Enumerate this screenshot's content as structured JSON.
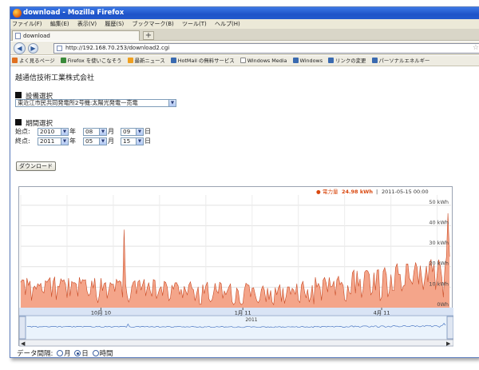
{
  "window": {
    "title": "download - Mozilla Firefox"
  },
  "menu": [
    "ファイル(F)",
    "編集(E)",
    "表示(V)",
    "履歴(S)",
    "ブックマーク(B)",
    "ツール(T)",
    "ヘルプ(H)"
  ],
  "tab": {
    "label": "download",
    "new_tab": "+"
  },
  "nav": {
    "back": "◀",
    "forward": "▶",
    "url": "http://192.168.70.253/download2.cgi",
    "star": "☆"
  },
  "bookmarks": [
    {
      "label": "よく見るページ",
      "color": "#e07020"
    },
    {
      "label": "Firefox を使いこなそう",
      "color": "#3a8a3a"
    },
    {
      "label": "最新ニュース",
      "color": "#f0a020"
    },
    {
      "label": "HotMail の無料サービス",
      "color": "#3a6ab0"
    },
    {
      "label": "Windows Media",
      "color": "#ffffff"
    },
    {
      "label": "Windows",
      "color": "#3a6ab0"
    },
    {
      "label": "リンクの変更",
      "color": "#3a6ab0"
    },
    {
      "label": "パーソナルエネルギー",
      "color": "#3a6ab0"
    }
  ],
  "page": {
    "company": "越通信技術工業株式会社",
    "equipment_heading": "設備選択",
    "equipment_value": "東近江市民共同発電所2号機:太陽光発電一売電",
    "period_heading": "期間選択",
    "start_label": "始点:",
    "end_label": "終点:",
    "start": {
      "year": "2010",
      "month": "08",
      "day": "09"
    },
    "end": {
      "year": "2011",
      "month": "05",
      "day": "15"
    },
    "unit_year": "年",
    "unit_month": "月",
    "unit_day": "日",
    "download_button": "ダウンロード",
    "interval_label": "データ間隔:",
    "interval_options": [
      {
        "label": "月",
        "selected": false
      },
      {
        "label": "日",
        "selected": true
      },
      {
        "label": "時間",
        "selected": false
      }
    ]
  },
  "chart_data": {
    "type": "area",
    "legend_marker": "●",
    "legend_series": "電力量",
    "legend_value": "24.98 kWh",
    "legend_datetime": "2011-05-15 00:00",
    "series_color": "#f4a58a",
    "line_color": "#c94a24",
    "ylim": [
      0,
      55
    ],
    "y_ticks": [
      "0Wh",
      "10 kWh",
      "20 kWh",
      "30 kWh",
      "40 kWh",
      "50 kWh"
    ],
    "y_tick_values": [
      0,
      10,
      20,
      30,
      40,
      50
    ],
    "x_tick_labels": [
      "10月 10",
      "1月 11",
      "4月 11"
    ],
    "x_tick_days": [
      52,
      144,
      234
    ],
    "navigator_label": "2011",
    "grid": true,
    "days": 280,
    "values": [
      12.5,
      13.6,
      13.4,
      6.3,
      14.4,
      11,
      12.9,
      3.5,
      9.6,
      10.5,
      9.1,
      11.7,
      10.7,
      11.8,
      8,
      7.2,
      13.1,
      12.4,
      13.6,
      14.6,
      5.4,
      12.9,
      15,
      3.9,
      10.5,
      10.1,
      14.1,
      12.9,
      13.6,
      11.5,
      4.9,
      14.3,
      5.7,
      12.8,
      12.1,
      12.2,
      11.5,
      5.6,
      14.8,
      11.8,
      13.7,
      13.3,
      13.6,
      7.9,
      5.9,
      6.8,
      13.1,
      9.6,
      14.4,
      5.6,
      2.4,
      6.3,
      14.3,
      8.3,
      11.7,
      12.2,
      4.6,
      8.2,
      12.2,
      11.3,
      11.5,
      7.9,
      13.8,
      12.4,
      13.1,
      12.5,
      5.1,
      38,
      11.3,
      5.8,
      2.8,
      4.8,
      10.3,
      12.5,
      13.1,
      6.8,
      12.6,
      13.4,
      8.6,
      11.2,
      13.8,
      5.8,
      9.7,
      12.2,
      7.9,
      5.6,
      13.7,
      13.3,
      4.5,
      6.6,
      9.2,
      10.2,
      5.9,
      12.8,
      12.3,
      10,
      3.5,
      4.6,
      10.9,
      9.1,
      12.1,
      12.2,
      10.7,
      6.5,
      9,
      4.8,
      10.4,
      8.2,
      6.3,
      11.1,
      12.6,
      9.5,
      8.7,
      3.4,
      6.8,
      10.1,
      1.6,
      1.7,
      11.2,
      6.9,
      10.7,
      12.5,
      4.3,
      2.9,
      3.8,
      7.1,
      11.9,
      8.2,
      7.1,
      12.4,
      11.7,
      4.6,
      8.1,
      6.4,
      8.3,
      10.2,
      11.6,
      2.9,
      1.5,
      2.4,
      9.5,
      8.2,
      2.5,
      1.5,
      2.1,
      8.8,
      11.9,
      11.2,
      10.9,
      5.3,
      9.5,
      9.7,
      6.4,
      3.4,
      2.4,
      3.9,
      8.9,
      10.6,
      8.5,
      2.9,
      9.5,
      4,
      8.4,
      2.6,
      1.5,
      9.8,
      6.3,
      9.5,
      11.1,
      3,
      9.5,
      2.1,
      5.5,
      10.1,
      10.1,
      6.5,
      9.4,
      8.6,
      6.5,
      11.7,
      3.6,
      2.5,
      11.1,
      12.8,
      7.7,
      4.8,
      8.9,
      2.8,
      5.2,
      10.9,
      1.8,
      14.8,
      10.1,
      11.8,
      10,
      3.6,
      13.4,
      14.7,
      12.1,
      7.7,
      14.7,
      10.1,
      10.5,
      13,
      6.1,
      13.6,
      15.3,
      11.3,
      12.4,
      10.9,
      3.8,
      3.2,
      10.8,
      7.3,
      6.7,
      17,
      18.3,
      7.1,
      17.9,
      10.5,
      14,
      5,
      9.1,
      17.3,
      18.2,
      17.9,
      16.1,
      6.3,
      7.6,
      17,
      8.6,
      18.3,
      18.5,
      3.4,
      5.1,
      17.8,
      19.5,
      16.2,
      5.3,
      7.8,
      16.1,
      8.4,
      8.3,
      19.5,
      21.5,
      16.1,
      16.2,
      8.1,
      10.5,
      11,
      21.3,
      21.3,
      14.4,
      13,
      11.5,
      17.8,
      22,
      19.6,
      11.5,
      20.4,
      14.3,
      8.8,
      14.5,
      20.3,
      12.6,
      22,
      23.4,
      17.5,
      20.9,
      8.8,
      16.3,
      23.4,
      20.5,
      14.8,
      5.2,
      19.4,
      24.5,
      46,
      24.98
    ]
  }
}
